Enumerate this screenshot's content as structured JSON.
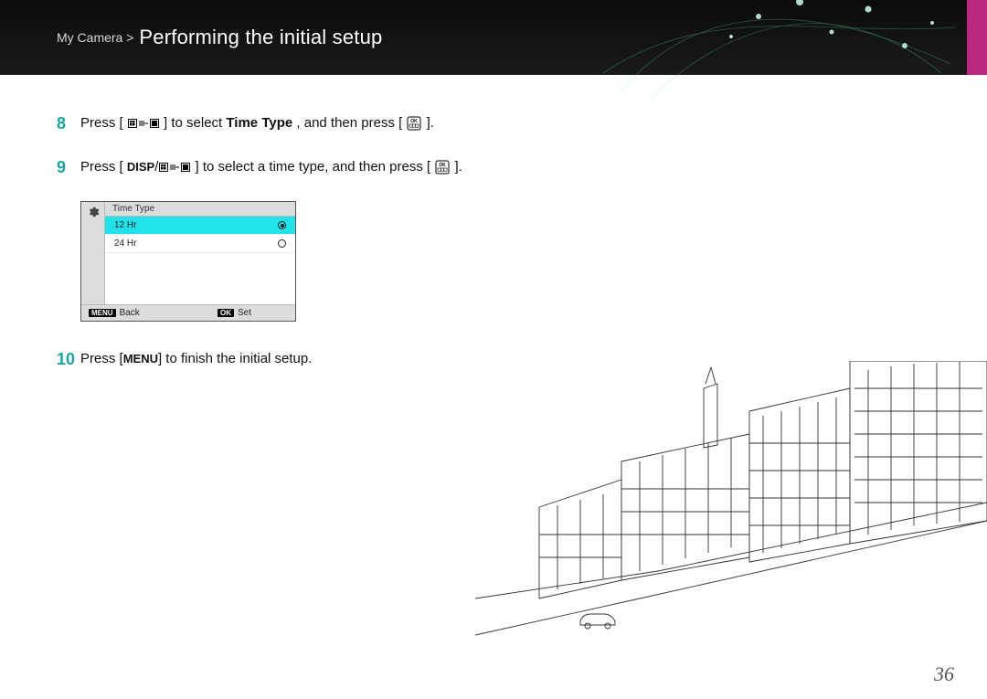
{
  "header": {
    "breadcrumb": "My Camera >",
    "title": "Performing the initial setup"
  },
  "steps": {
    "s8": {
      "num": "8",
      "press": "Press [",
      "mid": "] to select ",
      "bold": "Time Type",
      "tail1": ", and then press [",
      "tail2": "]."
    },
    "s9": {
      "num": "9",
      "press": "Press [",
      "disp": "DISP",
      "mid": "] to select a time type, and then press [",
      "tail": "]."
    },
    "s10": {
      "num": "10",
      "press": "Press [",
      "menu": "MENU",
      "tail": "] to finish the initial setup."
    }
  },
  "screen": {
    "title": "Time Type",
    "opt1": "12 Hr",
    "opt2": "24 Hr",
    "menu_btn": "MENU",
    "back": "Back",
    "ok_btn": "OK",
    "set": "Set"
  },
  "page_number": "36"
}
